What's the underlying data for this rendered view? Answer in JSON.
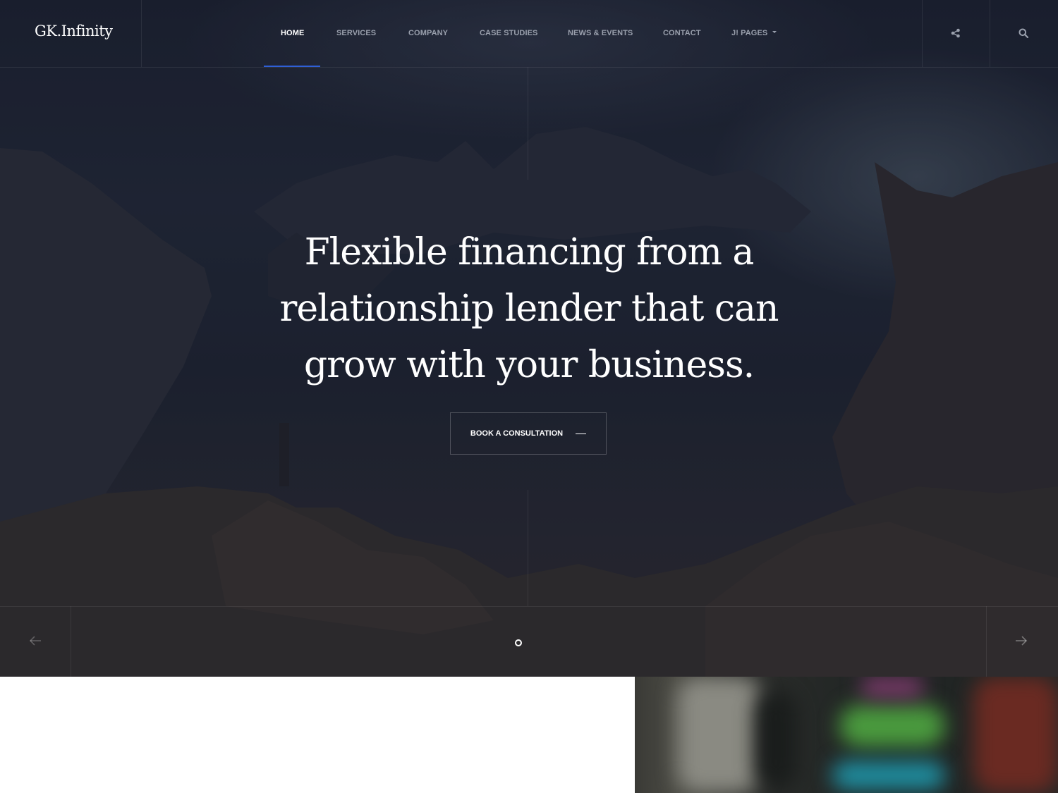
{
  "header": {
    "logo": "GK.Infinity",
    "nav": [
      {
        "label": "HOME",
        "active": true
      },
      {
        "label": "SERVICES",
        "active": false
      },
      {
        "label": "COMPANY",
        "active": false
      },
      {
        "label": "CASE STUDIES",
        "active": false
      },
      {
        "label": "NEWS & EVENTS",
        "active": false
      },
      {
        "label": "CONTACT",
        "active": false
      },
      {
        "label": "J! PAGES",
        "active": false,
        "has_dropdown": true
      }
    ],
    "icons": [
      "share-icon",
      "search-icon"
    ],
    "accent_color": "#2f5fd6"
  },
  "hero": {
    "headline_line1": "Flexible financing from a",
    "headline_line2": "relationship lender that can",
    "headline_line3": "grow with your business.",
    "cta_label": "BOOK A CONSULTATION",
    "slider": {
      "current_slide": 1,
      "dots": 1
    },
    "arrows": [
      "arrow-left-icon",
      "arrow-right-icon"
    ]
  }
}
